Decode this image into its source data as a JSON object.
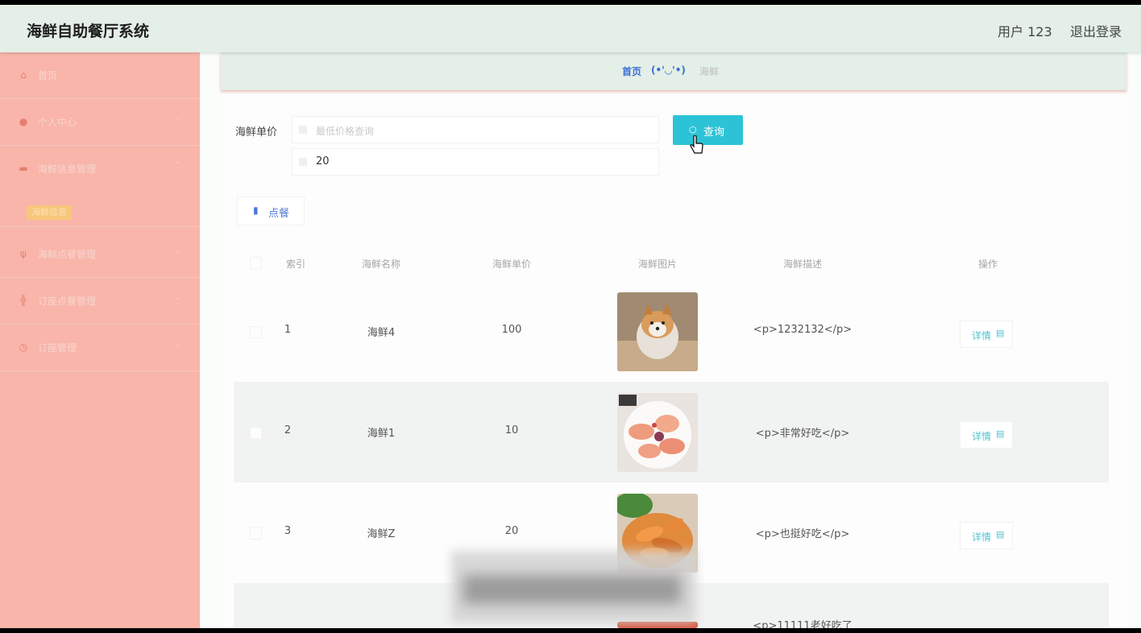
{
  "header": {
    "app_title": "海鲜自助餐厅系统",
    "user_label": "用户 123",
    "logout_label": "退出登录"
  },
  "sidebar": {
    "items": [
      {
        "label": "首页",
        "icon": "home-icon"
      },
      {
        "label": "个人中心",
        "icon": "person-icon",
        "has_arrow": true
      },
      {
        "label": "海鲜信息管理",
        "icon": "monitor-icon",
        "has_arrow": true
      },
      {
        "label": "海鲜信息",
        "submenu": true
      },
      {
        "label": "海鲜点餐管理",
        "icon": "fork-icon",
        "has_arrow": true
      },
      {
        "label": "订座点餐管理",
        "icon": "chair-icon",
        "has_arrow": true
      },
      {
        "label": "订座管理",
        "icon": "clock-icon",
        "has_arrow": true
      }
    ]
  },
  "breadcrumb": {
    "home": "首页",
    "face": "(•'◡'•)",
    "current": "海鲜"
  },
  "search": {
    "label": "海鲜单价",
    "min_placeholder": "最低价格查询",
    "max_value": "20",
    "query_button": "查询",
    "chart_button": "点餐"
  },
  "table": {
    "headers": [
      "索引",
      "海鲜名称",
      "海鲜单价",
      "海鲜图片",
      "海鲜描述",
      "操作"
    ],
    "rows": [
      {
        "index": "1",
        "name": "海鲜4",
        "price": "100",
        "desc": "<p>1232132</p>",
        "action": "详情",
        "image": "shiba-dog-photo"
      },
      {
        "index": "2",
        "name": "海鲜1",
        "price": "10",
        "desc": "<p>非常好吃</p>",
        "action": "详情",
        "image": "seafood-plate-photo"
      },
      {
        "index": "3",
        "name": "海鲜Z",
        "price": "20",
        "desc": "<p>也挺好吃</p>",
        "action": "详情",
        "image": "shrimp-photo"
      },
      {
        "index": "",
        "name": "",
        "price": "",
        "desc": "<p>11111老好吃了",
        "action": "",
        "image": "seafood-photo"
      }
    ]
  },
  "colors": {
    "sidebar_bg": "#f9b5aa",
    "header_bg": "#e3efe7",
    "accent": "#2cc3d6",
    "breadcrumb_link": "#3a6fd4"
  }
}
